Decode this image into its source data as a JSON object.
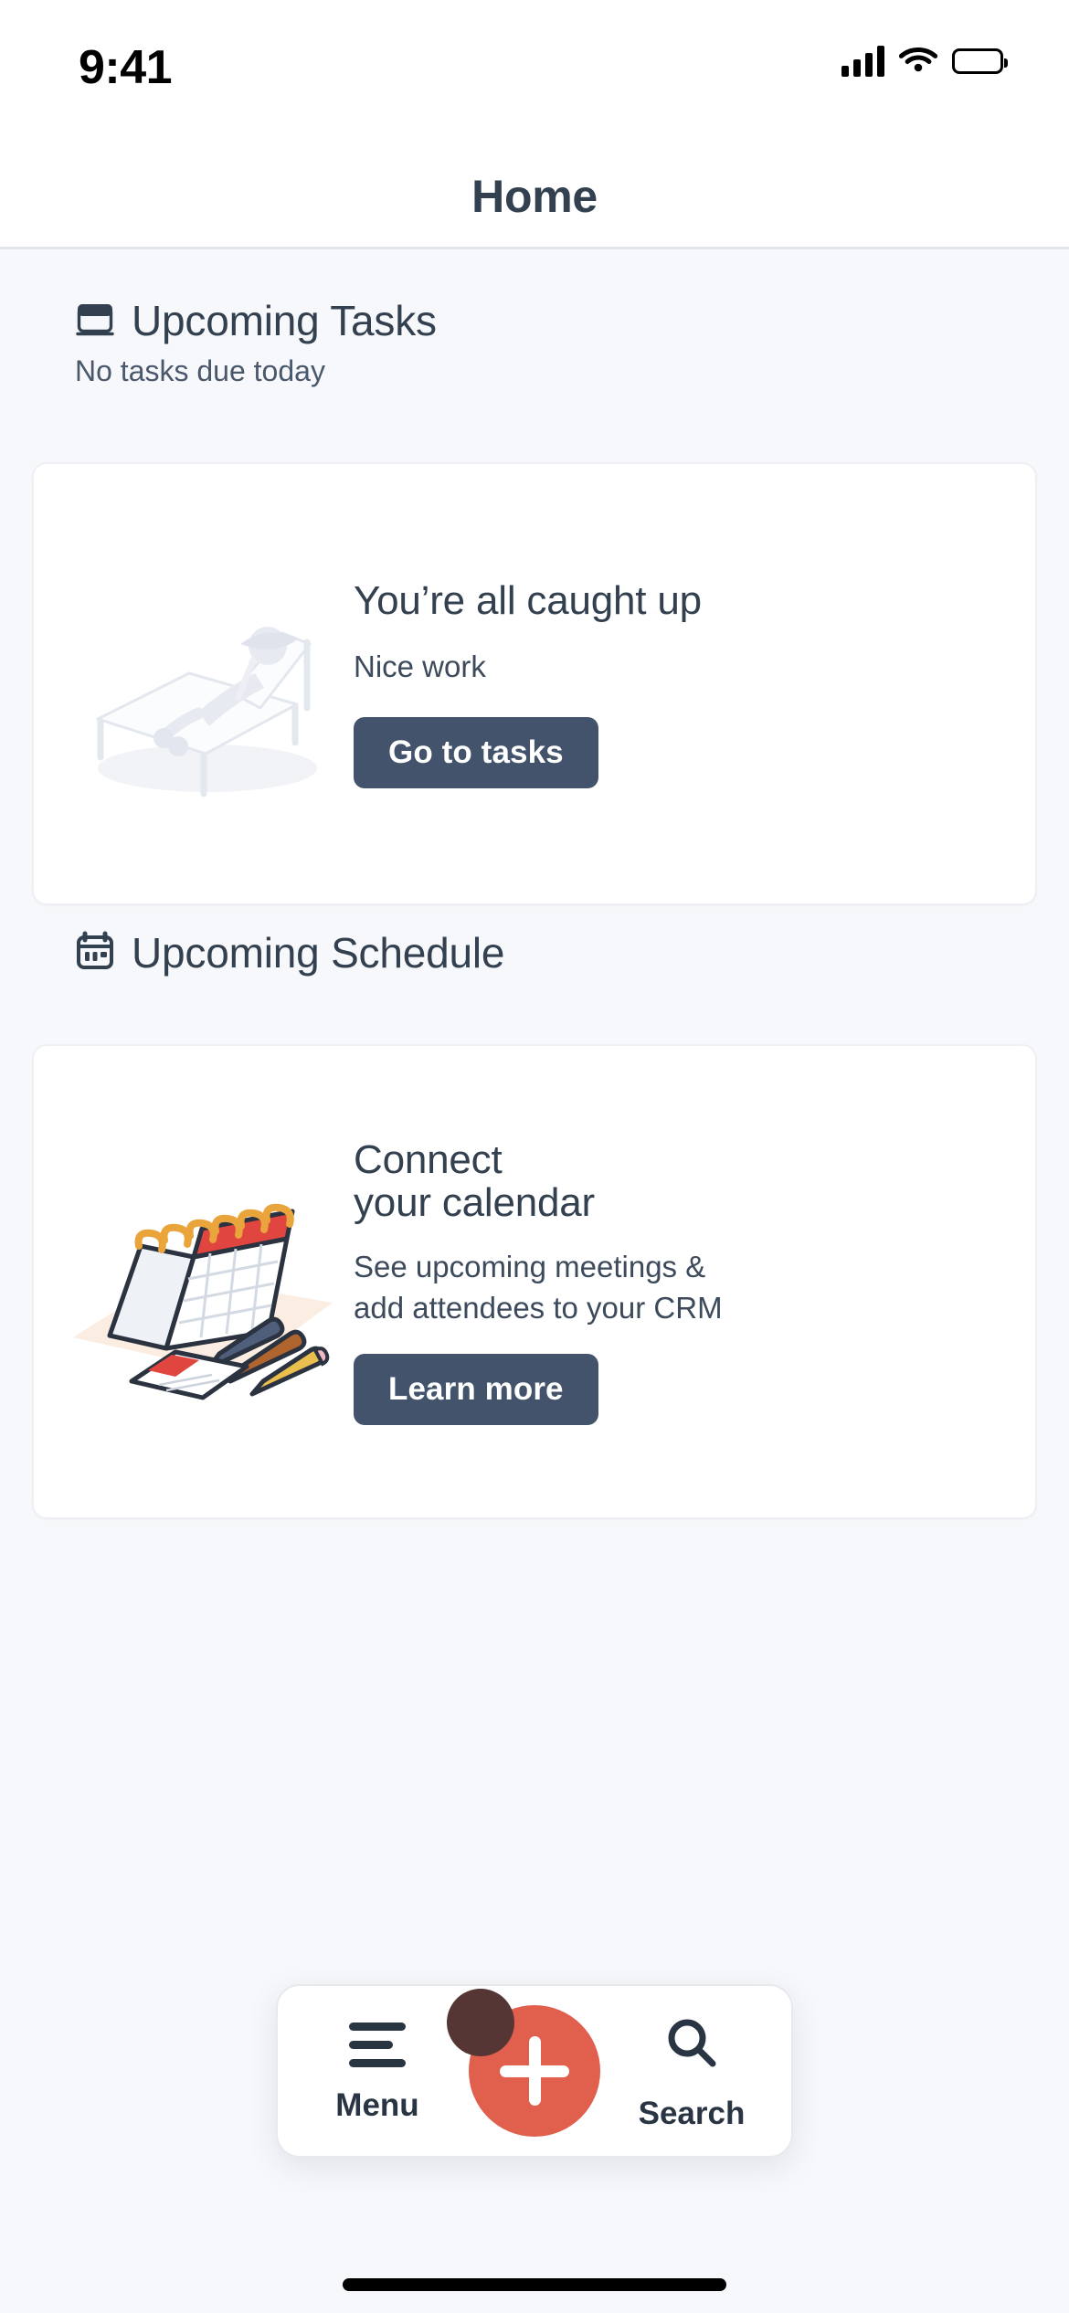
{
  "status_bar": {
    "time": "9:41",
    "cellular_icon": "signal-bars-icon",
    "wifi_icon": "wifi-icon",
    "battery_icon": "battery-icon"
  },
  "header": {
    "title": "Home"
  },
  "sections": [
    {
      "id": "upcoming-tasks",
      "icon": "notebook-icon",
      "title": "Upcoming Tasks",
      "subtitle": "No tasks due today",
      "card": {
        "illustration": "person-lounging-on-chair-illustration",
        "title": "You’re all caught up",
        "description": "Nice work",
        "button_label": "Go to tasks"
      }
    },
    {
      "id": "upcoming-schedule",
      "icon": "calendar-icon",
      "title": "Upcoming Schedule",
      "subtitle": "",
      "card": {
        "illustration": "desk-calendar-with-pens-illustration",
        "title_line1": "Connect",
        "title_line2": "your calendar",
        "description_line1": "See upcoming meetings &",
        "description_line2": "add attendees to your CRM",
        "button_label": "Learn more"
      }
    }
  ],
  "tabbar": {
    "menu": {
      "label": "Menu",
      "icon": "hamburger-menu-icon"
    },
    "create": {
      "label": "",
      "icon": "plus-icon"
    },
    "search": {
      "label": "Search",
      "icon": "search-icon"
    }
  },
  "colors": {
    "page_background": "#F7F8FB",
    "surface": "#FFFFFF",
    "text_primary": "#33404F",
    "text_secondary": "#49586B",
    "button_primary": "#43536B",
    "accent_fab": "#E05F4D",
    "cursor": "#553634"
  }
}
